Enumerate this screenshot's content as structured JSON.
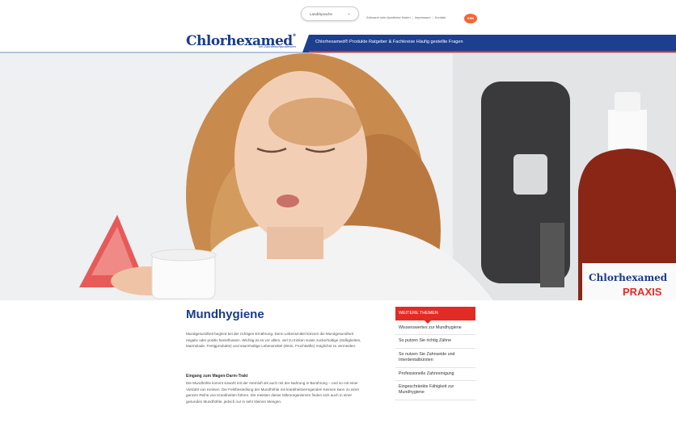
{
  "header": {
    "language_selector": "Land/Sprache",
    "links": [
      "Zahnarzt oder Apotheke finden",
      "Impressum",
      "Kontakt"
    ],
    "company_logo": "GSK",
    "brand": "Chlorhexamed",
    "brand_mark": "®",
    "brand_tagline": "bei Zahnfleischproblemen"
  },
  "nav": {
    "items": [
      "Chlorhexamed® Produkte",
      "Ratgeber & Fachkreise",
      "Häufig gestellte Fragen"
    ]
  },
  "hero": {
    "bottle_brand": "Chlorhexamed",
    "bottle_product": "PRAXIS"
  },
  "article": {
    "title": "Mundhygiene",
    "paragraph1": "Mundgesundheit beginnt bei der richtigen Ernährung. Denn Lebensmittel können die Mundgesundheit negativ oder positiv beeinflussen. Wichtig ist es vor allem, viel zu trinken sowie zuckerhaltige (Süßigkeiten, Marmelade, Fertigprodukte) und säurehaltige Lebensmittel (Wein, Fruchtsäfte) möglichst zu vermeiden.",
    "subheading": "Eingang zum Magen-Darm-Trakt",
    "paragraph2": "Die Mundhöhle kommt sowohl mit der Atemluft als auch mit der Nahrung in Berührung – und so mit einer Vielzahl von Keimen. Die Fehlbesiedlung der Mundhöhle mit krankheitserregenden Keimen kann zu einer ganzen Reihe von Krankheiten führen. Die meisten dieser Mikroorganismen finden sich auch in einer gesunden Mundhöhle, jedoch nur in sehr kleinen Mengen."
  },
  "sidebar": {
    "heading": "WEITERE THEMEN",
    "items": [
      "Wissenswertes zur Mundhygiene",
      "So putzen Sie richtig Zähne",
      "So nutzen Sie Zahnseide und Interdentalbürsten",
      "Professionelle Zahnreinigung",
      "Eingeschränkte Fähigkeit zur Mundhygiene"
    ]
  },
  "colors": {
    "brand_blue": "#1c3f8f",
    "accent_red": "#e22b25",
    "gsk_orange": "#f36633"
  }
}
